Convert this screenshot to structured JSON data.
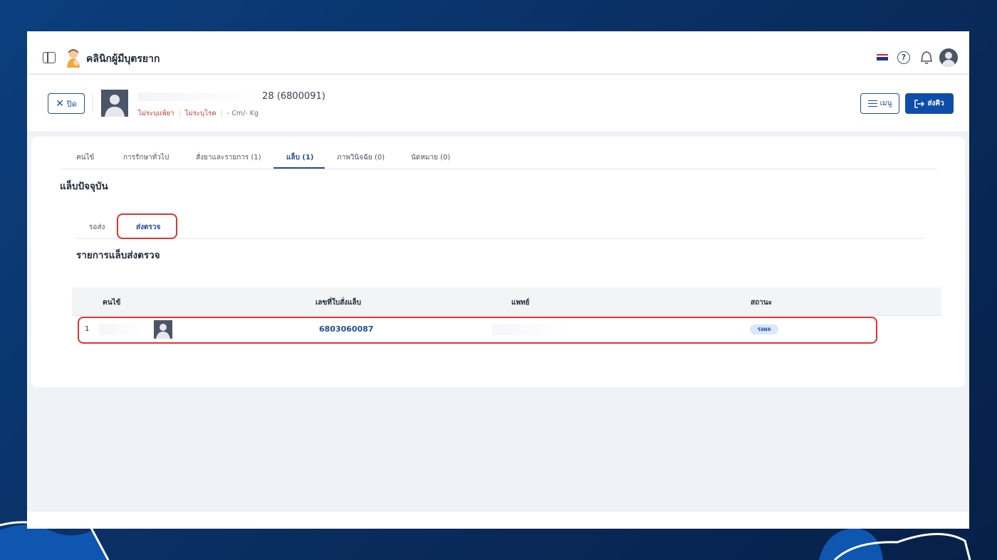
{
  "app": {
    "brand_name": "คลินิกผู้มีบุตรยาก",
    "colors": {
      "primary": "#0f4ea8",
      "highlight": "#e0332f",
      "badge_bg": "#dbe7fb"
    }
  },
  "topbar_icons": [
    "sidebar-toggle-icon",
    "clinic-logo",
    "thai-flag-icon",
    "help-icon",
    "bell-icon",
    "user-avatar"
  ],
  "patient": {
    "name_suffix": "28 (6800091)",
    "allergy": "ไม่ระบุแพ้ยา",
    "disease": "ไม่ระบุโรค",
    "body": "- Cm/- Kg"
  },
  "actions": {
    "close_label": "ปิด",
    "menu_label": "เมนู",
    "send_label": "ส่งคิว"
  },
  "tabs": [
    {
      "label": "คนไข้"
    },
    {
      "label": "การรักษาทั่วไป"
    },
    {
      "label": "สั่งยาและรายการ (1)"
    },
    {
      "label": "แล็บ (1)",
      "active": true
    },
    {
      "label": "ภาพวินิจฉัย (0)"
    },
    {
      "label": "นัดหมาย (0)"
    }
  ],
  "lab": {
    "section_title": "แล็บปัจจุบัน",
    "subtabs": [
      {
        "label": "รอส่ง"
      },
      {
        "label": "ส่งตรวจ",
        "active": true
      }
    ],
    "list_title": "รายการแล็บส่งตรวจ",
    "columns": [
      "คนไข้",
      "เลขที่ใบสั่งแล็บ",
      "แพทย์",
      "สถานะ"
    ],
    "rows": [
      {
        "index": "1",
        "order_no": "6803060087",
        "status": "รอผล"
      }
    ]
  }
}
